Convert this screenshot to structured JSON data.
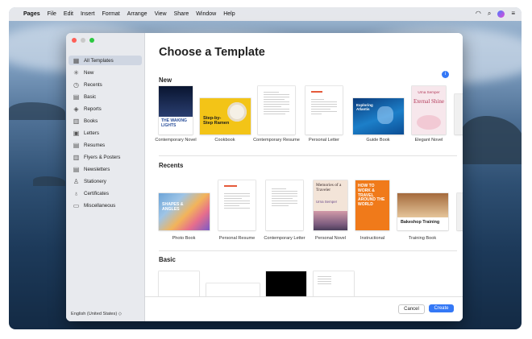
{
  "menubar": {
    "app": "Pages",
    "items": [
      "File",
      "Edit",
      "Insert",
      "Format",
      "Arrange",
      "View",
      "Share",
      "Window",
      "Help"
    ]
  },
  "sidebar": {
    "items": [
      {
        "label": "All Templates",
        "icon": "grid-icon"
      },
      {
        "label": "New",
        "icon": "sparkle-icon"
      },
      {
        "label": "Recents",
        "icon": "clock-icon"
      },
      {
        "label": "Basic",
        "icon": "document-icon"
      },
      {
        "label": "Reports",
        "icon": "report-icon"
      },
      {
        "label": "Books",
        "icon": "book-icon"
      },
      {
        "label": "Letters",
        "icon": "letter-icon"
      },
      {
        "label": "Resumes",
        "icon": "resume-icon"
      },
      {
        "label": "Flyers & Posters",
        "icon": "flyer-icon"
      },
      {
        "label": "Newsletters",
        "icon": "newsletter-icon"
      },
      {
        "label": "Stationery",
        "icon": "stationery-icon"
      },
      {
        "label": "Certificates",
        "icon": "certificate-icon"
      },
      {
        "label": "Miscellaneous",
        "icon": "misc-icon"
      }
    ],
    "language": "English (United States) ◇"
  },
  "main": {
    "title": "Choose a Template",
    "sections": {
      "new": "New",
      "recents": "Recents",
      "basic": "Basic"
    },
    "new_templates": [
      "Contemporary Novel",
      "Cookbook",
      "Contemporary Resume",
      "Personal Letter",
      "Guide Book",
      "Elegant Novel"
    ],
    "recent_templates": [
      "Photo Book",
      "Personal Resume",
      "Contemporary Letter",
      "Personal Novel",
      "Instructional",
      "Training Book"
    ],
    "thumbs": {
      "novel_title": "THE WAKING LIGHTS",
      "cookbook_title": "Step-by-Step Ramen",
      "guide_title": "Exploring Atlantis",
      "elegant_author": "Urna Semper",
      "elegant_title": "Eternal Shine",
      "photo_title": "SHAPES & ANGLES",
      "memories_title": "Memories of a Traveler",
      "memories_author": "Urna Semper",
      "instructional_title": "HOW TO WORK & TRAVEL AROUND THE WORLD",
      "training_title": "Bakeshop Training"
    }
  },
  "footer": {
    "cancel": "Cancel",
    "create": "Create"
  }
}
